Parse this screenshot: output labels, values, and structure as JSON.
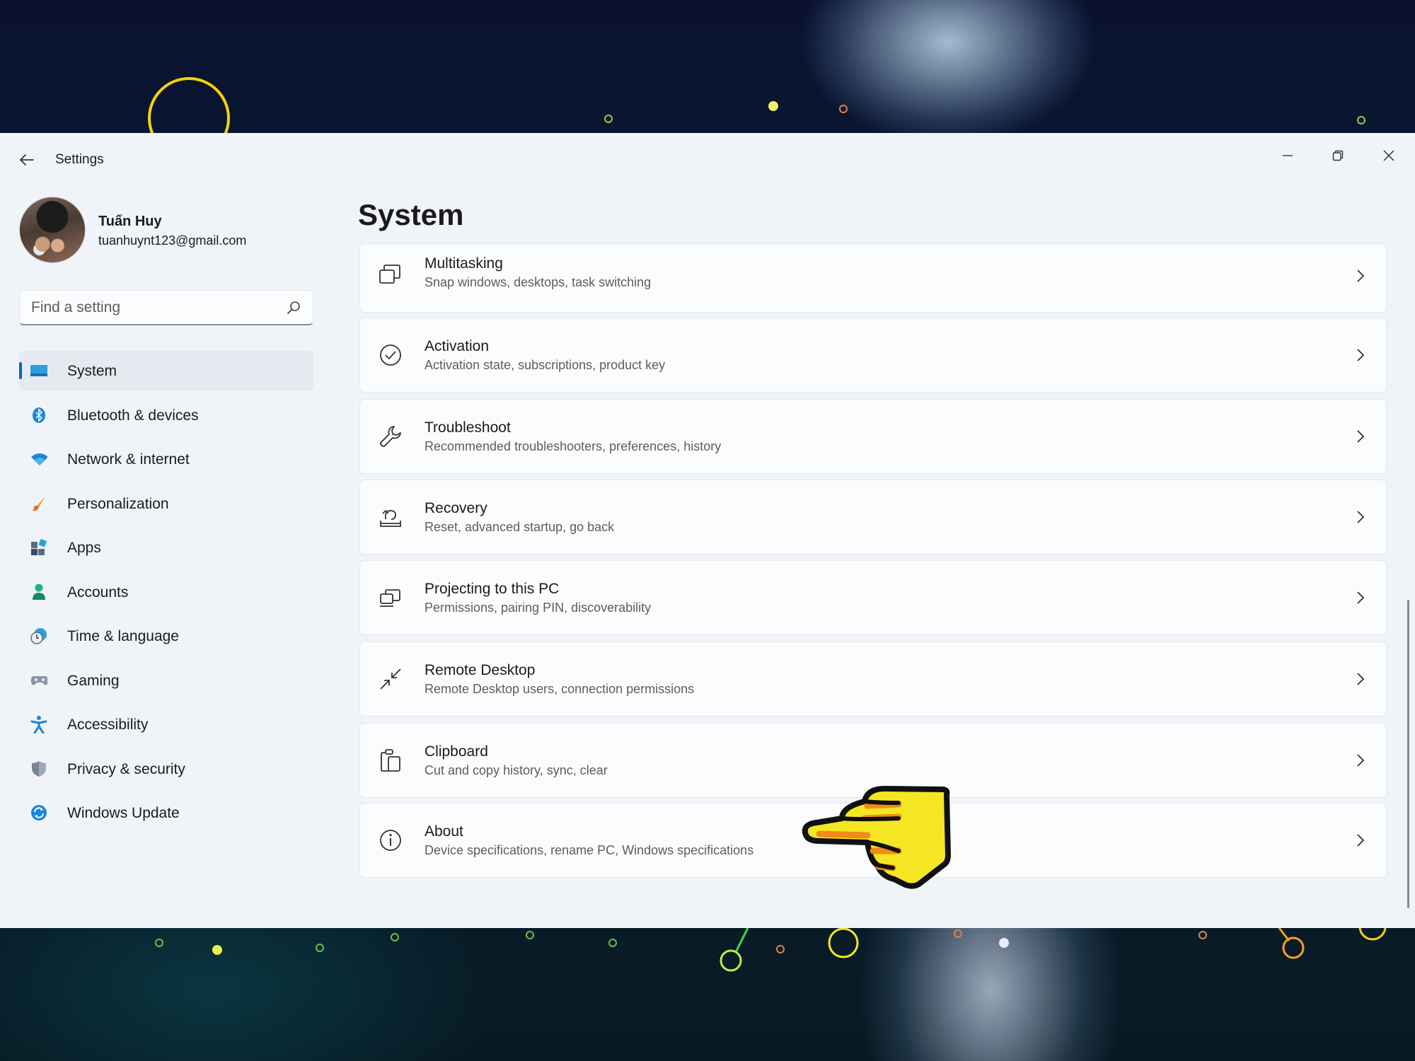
{
  "window": {
    "title": "Settings"
  },
  "profile": {
    "name": "Tuấn Huy",
    "email": "tuanhuynt123@gmail.com"
  },
  "search": {
    "placeholder": "Find a setting"
  },
  "sidebar": {
    "items": [
      {
        "label": "System",
        "icon": "system-icon",
        "active": true
      },
      {
        "label": "Bluetooth & devices",
        "icon": "bluetooth-icon"
      },
      {
        "label": "Network & internet",
        "icon": "wifi-icon"
      },
      {
        "label": "Personalization",
        "icon": "brush-icon"
      },
      {
        "label": "Apps",
        "icon": "apps-icon"
      },
      {
        "label": "Accounts",
        "icon": "person-icon"
      },
      {
        "label": "Time & language",
        "icon": "clock-globe-icon"
      },
      {
        "label": "Gaming",
        "icon": "gamepad-icon"
      },
      {
        "label": "Accessibility",
        "icon": "accessibility-icon"
      },
      {
        "label": "Privacy & security",
        "icon": "shield-icon"
      },
      {
        "label": "Windows Update",
        "icon": "update-icon"
      }
    ]
  },
  "main": {
    "title": "System",
    "items": [
      {
        "title": "Multitasking",
        "subtitle": "Snap windows, desktops, task switching",
        "icon": "multitasking-icon"
      },
      {
        "title": "Activation",
        "subtitle": "Activation state, subscriptions, product key",
        "icon": "check-circle-icon"
      },
      {
        "title": "Troubleshoot",
        "subtitle": "Recommended troubleshooters, preferences, history",
        "icon": "wrench-icon"
      },
      {
        "title": "Recovery",
        "subtitle": "Reset, advanced startup, go back",
        "icon": "recovery-icon"
      },
      {
        "title": "Projecting to this PC",
        "subtitle": "Permissions, pairing PIN, discoverability",
        "icon": "projecting-icon"
      },
      {
        "title": "Remote Desktop",
        "subtitle": "Remote Desktop users, connection permissions",
        "icon": "remote-desktop-icon"
      },
      {
        "title": "Clipboard",
        "subtitle": "Cut and copy history, sync, clear",
        "icon": "clipboard-icon"
      },
      {
        "title": "About",
        "subtitle": "Device specifications, rename PC, Windows specifications",
        "icon": "info-icon"
      }
    ]
  },
  "colors": {
    "accent": "#0067c0",
    "window_bg": "#f0f4f9",
    "card_bg": "#fbfcfd",
    "pointer_hand": "#f5e623"
  }
}
